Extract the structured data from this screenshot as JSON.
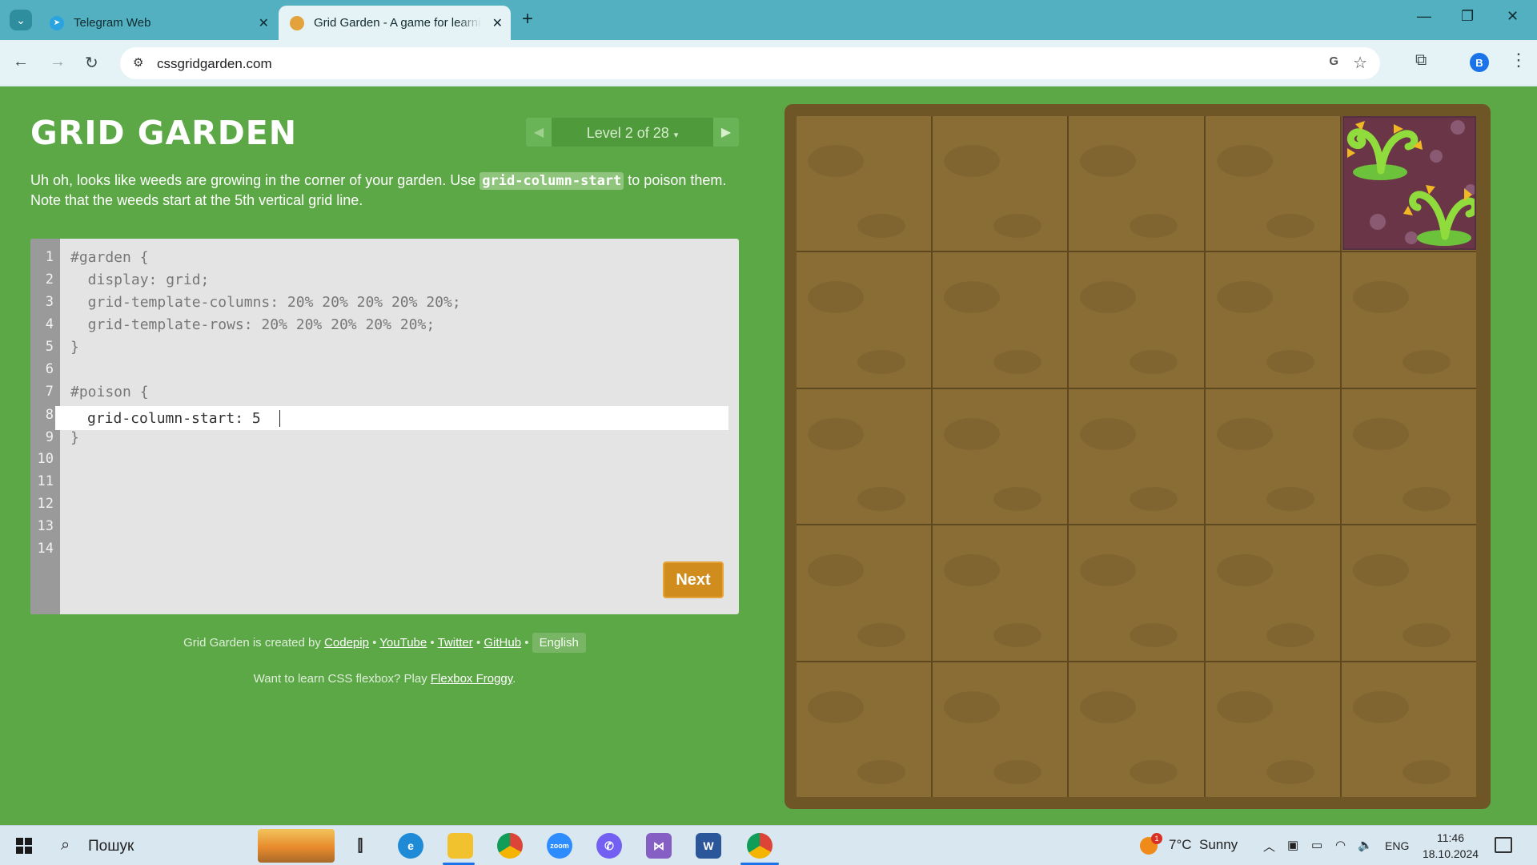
{
  "browser": {
    "tabs": [
      {
        "title": "Telegram Web",
        "icon": "telegram-icon"
      },
      {
        "title": "Grid Garden - A game for learning CSS grid",
        "icon": "grid-garden-favicon",
        "active": true
      }
    ],
    "url": "cssgridgarden.com",
    "profile_initial": "B"
  },
  "page": {
    "title": "GRID GARDEN",
    "level_label": "Level 2 of 28",
    "level_caret": "▾",
    "instructions": {
      "before": "Uh oh, looks like weeds are growing in the corner of your garden. Use ",
      "code": "grid-column-start",
      "after": " to poison them. Note that the weeds start at the 5th vertical grid line."
    },
    "editor": {
      "line_numbers": [
        "1",
        "2",
        "3",
        "4",
        "5",
        "6",
        "7",
        "8",
        "9",
        "10",
        "11",
        "12",
        "13",
        "14"
      ],
      "lines": [
        "#garden {",
        "  display: grid;",
        "  grid-template-columns: 20% 20% 20% 20% 20%;",
        "  grid-template-rows: 20% 20% 20% 20% 20%;",
        "}",
        "",
        "#poison {",
        "",
        "}"
      ],
      "input_value": "grid-column-start: 5",
      "next_label": "Next"
    },
    "footer": {
      "created_by": "Grid Garden is created by",
      "codepip": "Codepip",
      "youtube": "YouTube",
      "twitter": "Twitter",
      "github": "GitHub",
      "sep": "•",
      "language": "English",
      "flexbox_text": "Want to learn CSS flexbox? Play",
      "flexbox_link": "Flexbox Froggy",
      "period": "."
    },
    "garden": {
      "columns": 5,
      "rows": 5,
      "poison_column_start": 5,
      "poison_row": 1
    }
  },
  "taskbar": {
    "search_placeholder": "Пошук",
    "weather": "7°C  Sunny",
    "weather_badge": "1",
    "language": "ENG",
    "time": "11:46",
    "date": "18.10.2024",
    "apps": [
      "task-view-icon",
      "edge-icon",
      "file-explorer-icon",
      "chrome-icon",
      "zoom-icon",
      "viber-icon",
      "visual-studio-icon",
      "word-icon",
      "chrome-profile-icon"
    ]
  },
  "colors": {
    "page_bg": "#5ca846",
    "garden_soil": "#8a6c35",
    "poison": "#6a3647",
    "next_button": "#d08c1d"
  }
}
